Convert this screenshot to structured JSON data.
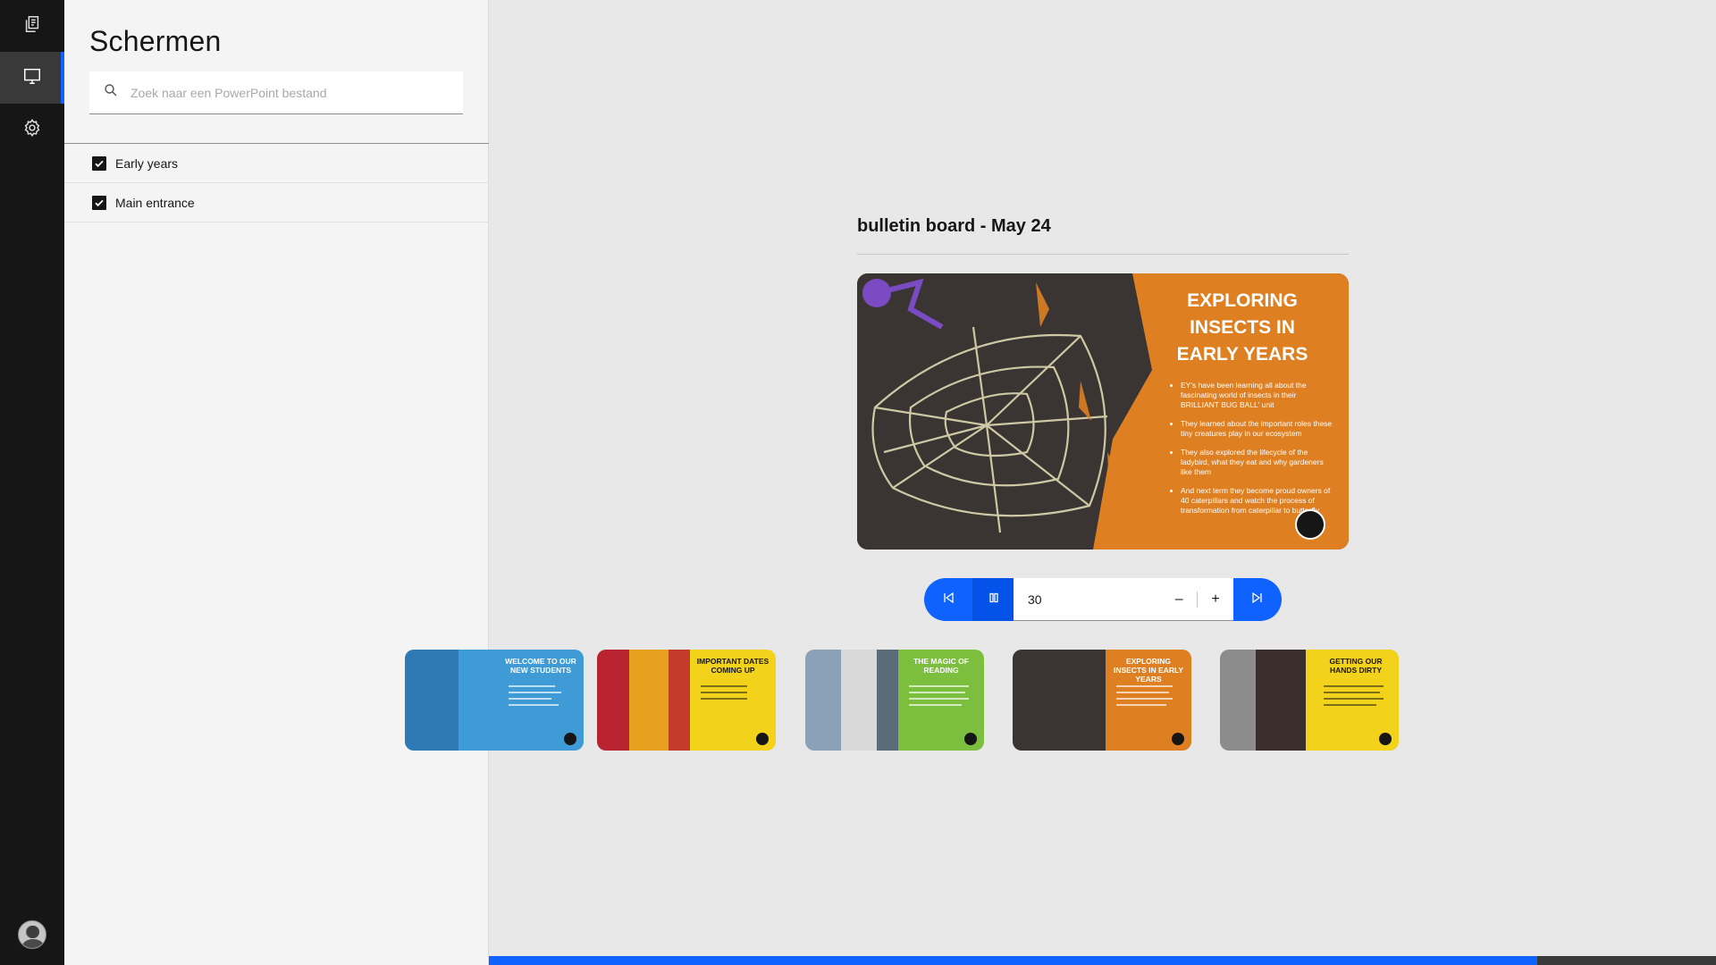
{
  "rail": {
    "items": [
      {
        "icon": "copy-icon",
        "active": false
      },
      {
        "icon": "monitor-icon",
        "active": true
      },
      {
        "icon": "settings-icon",
        "active": false
      }
    ],
    "avatar": "user-avatar"
  },
  "panel": {
    "title": "Schermen",
    "search": {
      "placeholder": "Zoek naar een PowerPoint bestand",
      "value": ""
    },
    "screens": [
      {
        "label": "Early years",
        "checked": true
      },
      {
        "label": "Main entrance",
        "checked": true
      }
    ]
  },
  "main": {
    "title": "bulletin board - May 24",
    "current_slide": {
      "heading": "EXPLORING INSECTS IN EARLY YEARS",
      "bullets": [
        "EY's have been learning all about the fascinating world of insects in their BRILLIANT BUG BALL' unit",
        "They learned about the important roles these tiny creatures play in our ecosystem",
        "They also explored the lifecycle of the ladybird, what they eat and why gardeners like them",
        "And next term they become proud owners of 40 caterpillars and watch the process of transformation from caterpillar to butterfly"
      ]
    },
    "controls": {
      "interval": "30",
      "minus": "–",
      "plus": "+"
    },
    "thumbnails": [
      {
        "title": "WELCOME TO OUR NEW STUDENTS",
        "bg": "#3e9bd6",
        "text_color": "#ffffff"
      },
      {
        "title": "IMPORTANT DATES COMING UP",
        "bg": "#f2d21b",
        "text_color": "#161616"
      },
      {
        "title": "THE MAGIC OF READING",
        "bg": "#7cbf3f",
        "text_color": "#ffffff"
      },
      {
        "title": "EXPLORING INSECTS IN EARLY YEARS",
        "bg": "#de7f22",
        "text_color": "#ffffff"
      },
      {
        "title": "GETTING OUR HANDS DIRTY",
        "bg": "#f2d21b",
        "text_color": "#161616"
      }
    ],
    "progress": 0.854
  },
  "colors": {
    "accent": "#0f62fe",
    "rail_bg": "#161616",
    "panel_bg": "#f4f4f4",
    "main_bg": "#e8e8e8"
  }
}
